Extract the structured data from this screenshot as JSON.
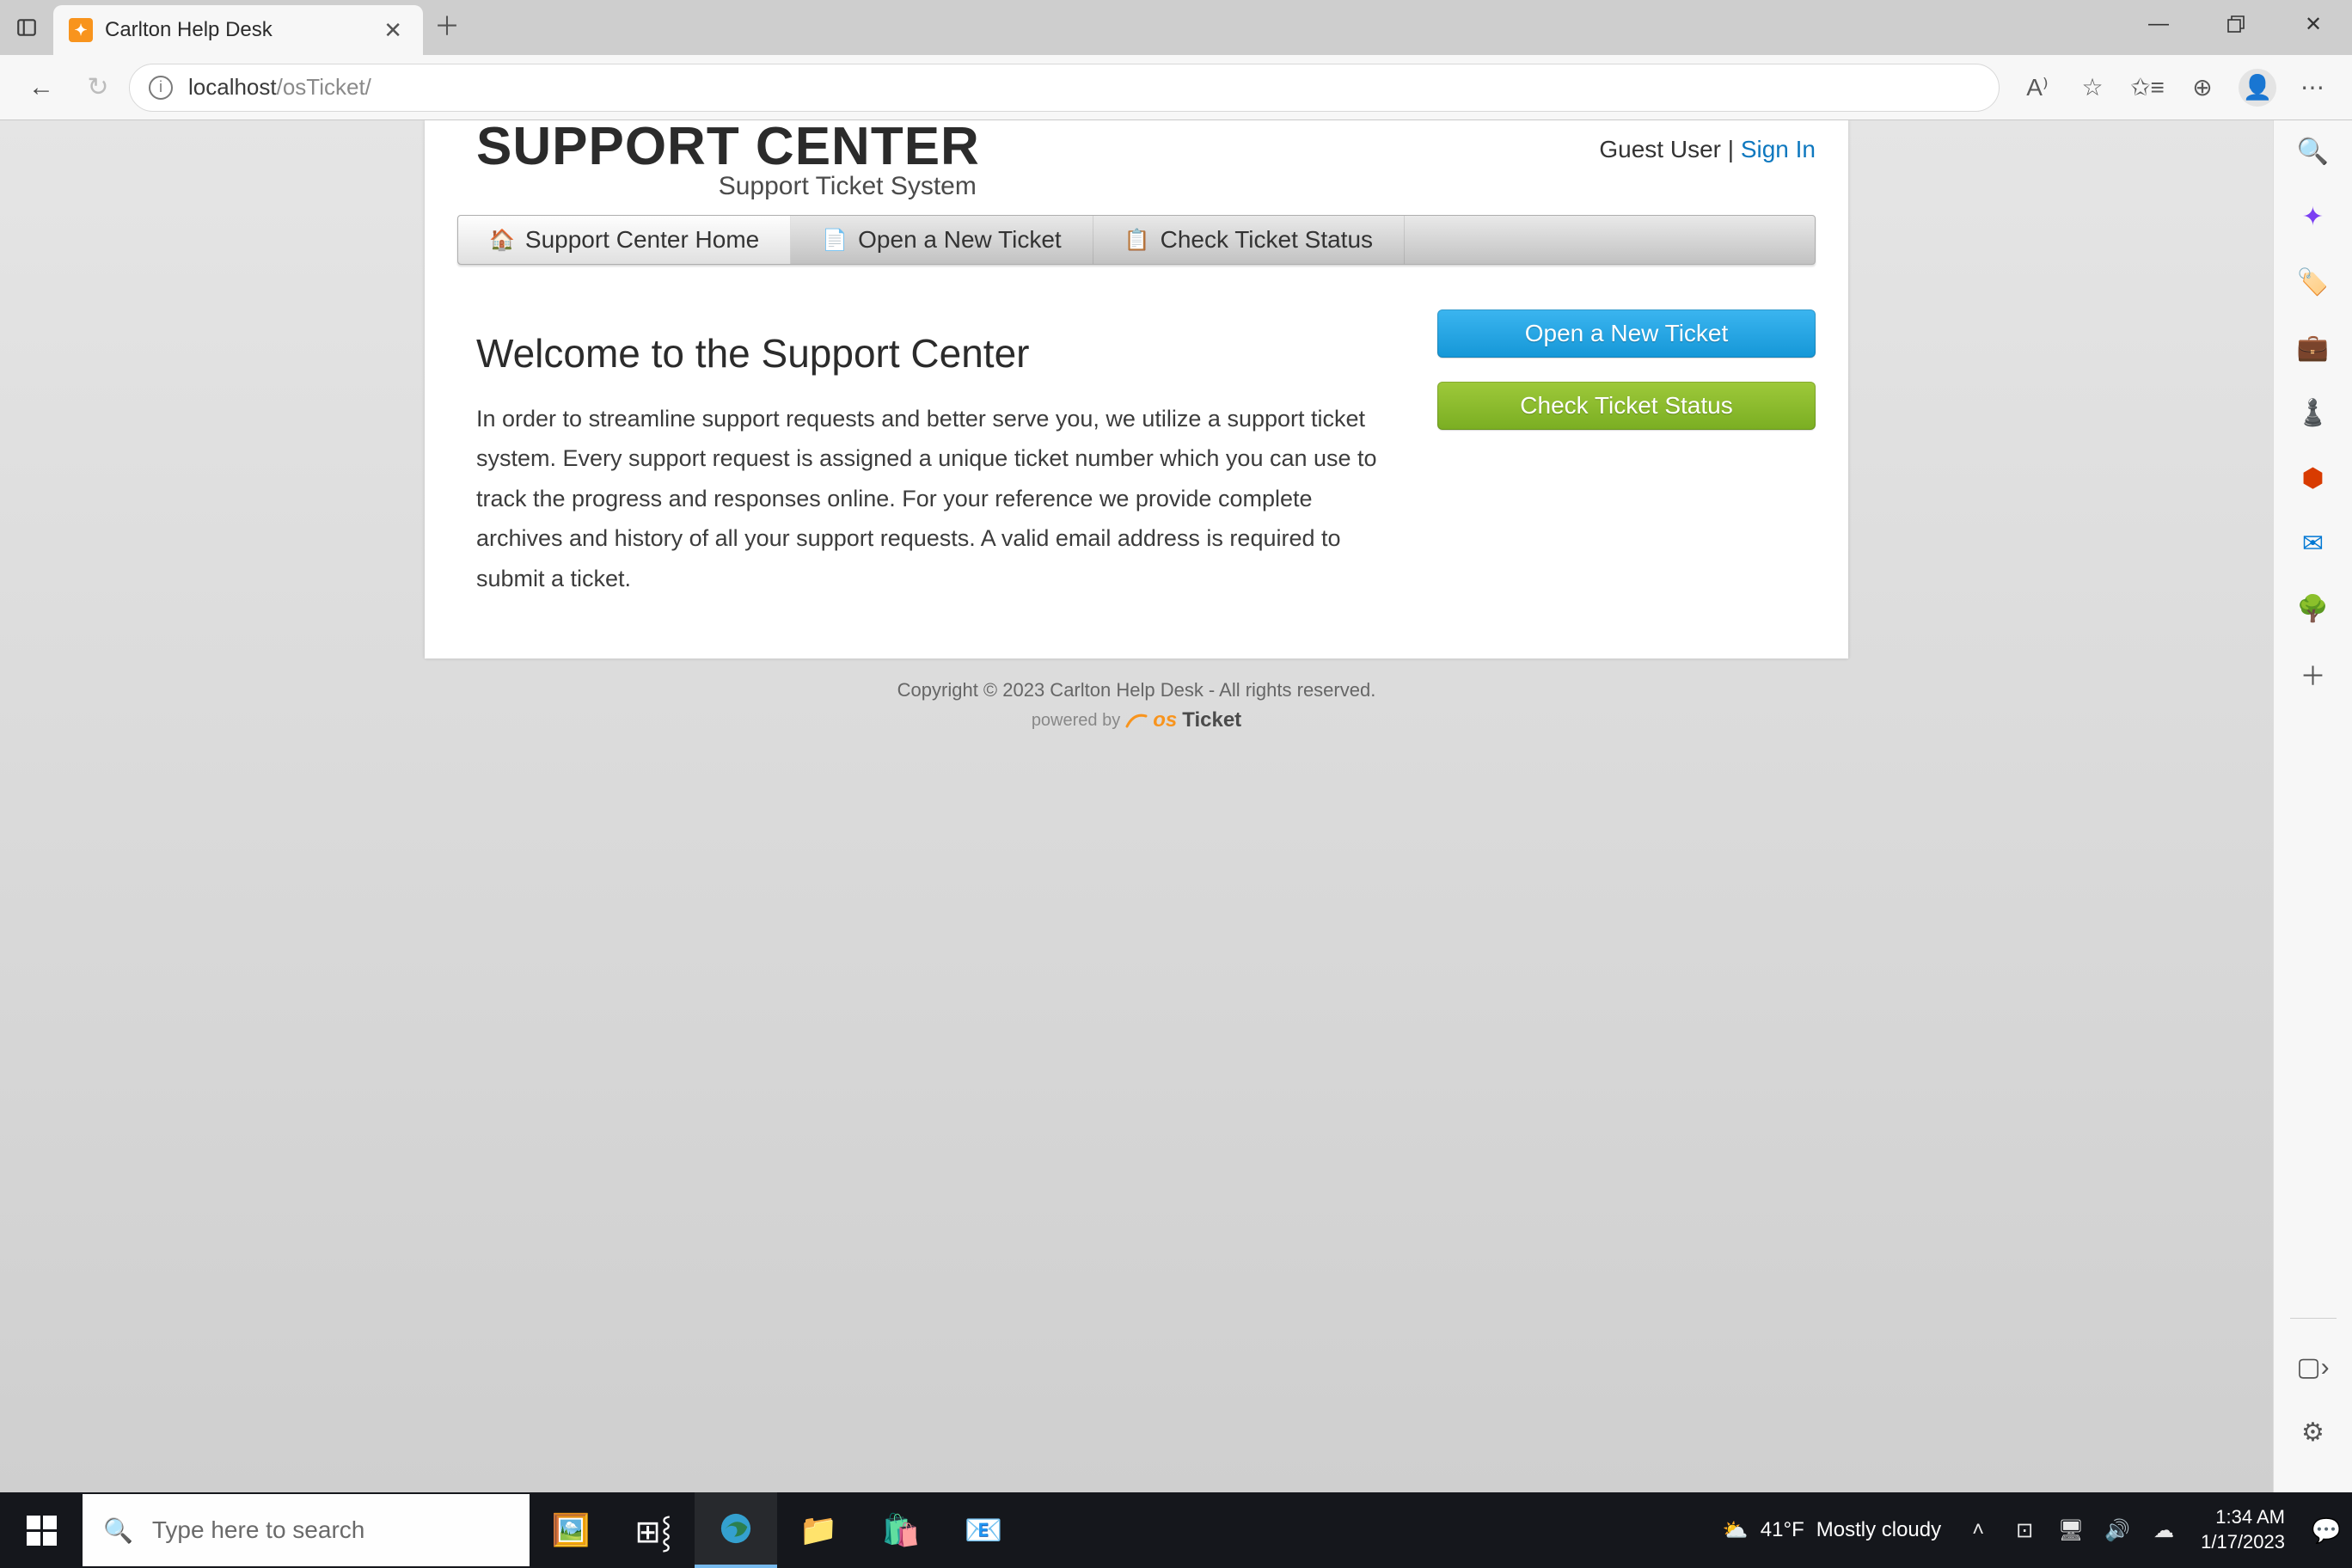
{
  "browser": {
    "tab_title": "Carlton Help Desk",
    "url_host": "localhost",
    "url_path": "/osTicket/"
  },
  "header": {
    "logo_main": "SUPPORT CENTER",
    "logo_sub": "Support Ticket System",
    "guest_label": "Guest User",
    "separator": " | ",
    "signin_label": "Sign In"
  },
  "nav": {
    "home": "Support Center Home",
    "open": "Open a New Ticket",
    "check": "Check Ticket Status"
  },
  "main": {
    "title": "Welcome to the Support Center",
    "body": "In order to streamline support requests and better serve you, we utilize a support ticket system. Every support request is assigned a unique ticket number which you can use to track the progress and responses online. For your reference we provide complete archives and history of all your support requests. A valid email address is required to submit a ticket."
  },
  "buttons": {
    "open_ticket": "Open a New Ticket",
    "check_status": "Check Ticket Status"
  },
  "footer": {
    "copyright": "Copyright © 2023 Carlton Help Desk - All rights reserved.",
    "powered_by": "powered by",
    "brand_os": "os",
    "brand_ticket": "Ticket"
  },
  "taskbar": {
    "search_placeholder": "Type here to search",
    "weather_temp": "41°F",
    "weather_desc": "Mostly cloudy",
    "time": "1:34 AM",
    "date": "1/17/2023"
  }
}
